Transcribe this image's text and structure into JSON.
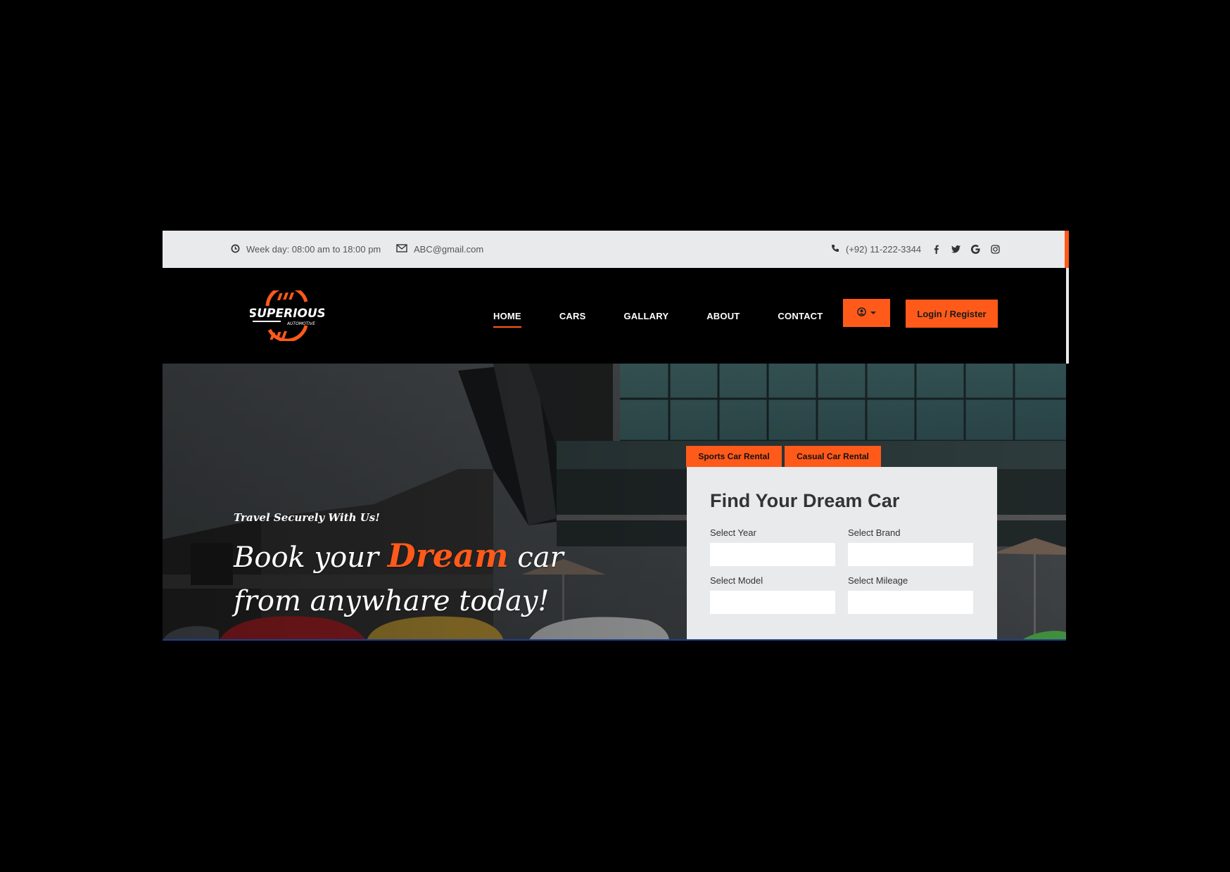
{
  "topbar": {
    "hours": "Week day: 08:00 am to 18:00 pm",
    "email": "ABC@gmail.com",
    "phone": "(+92) 11-222-3344",
    "social": [
      "facebook-icon",
      "twitter-icon",
      "google-icon",
      "instagram-icon"
    ]
  },
  "nav": {
    "brand": "SUPERIOUS",
    "brand_sub": "AUTOMOTIVE",
    "links": [
      "HOME",
      "CARS",
      "GALLARY",
      "ABOUT",
      "CONTACT"
    ],
    "active": "HOME",
    "login_label": "Login / Register"
  },
  "hero": {
    "kicker": "Travel Securely With Us!",
    "headline_pre": "Book your ",
    "headline_highlight": "Dream",
    "headline_post": " car from anywhare today!"
  },
  "search": {
    "tabs": [
      "Sports Car Rental",
      "Casual Car Rental"
    ],
    "title": "Find Your Dream Car",
    "fields": [
      {
        "label": "Select Year",
        "value": ""
      },
      {
        "label": "Select Brand",
        "value": ""
      },
      {
        "label": "Select Model",
        "value": ""
      },
      {
        "label": "Select Mileage",
        "value": ""
      }
    ]
  },
  "colors": {
    "accent": "#ff5a1a",
    "topbar_bg": "#e9eaec",
    "navbar_bg": "#000000"
  }
}
